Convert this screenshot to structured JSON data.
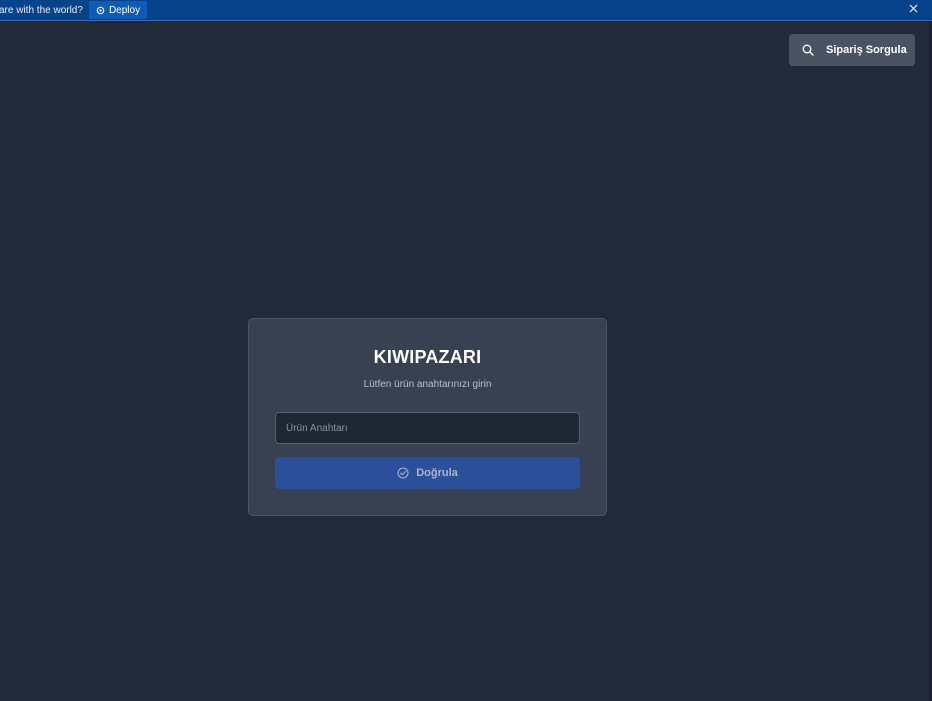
{
  "topbar": {
    "prompt_text": "are with the world?",
    "deploy_label": "Deploy",
    "icons": {
      "deploy": "rocket-icon",
      "close": "close-icon"
    }
  },
  "header": {
    "order_query_label": "Sipariş Sorgula",
    "icon": "search-icon"
  },
  "login_card": {
    "title": "KIWIPAZARI",
    "subtitle": "Lütfen ürün anahtarınızı girin",
    "key_input": {
      "value": "",
      "placeholder": "Ürün Anahtarı"
    },
    "verify_label": "Doğrula",
    "verify_icon": "check-circle-icon"
  },
  "colors": {
    "background": "#222938",
    "topbar": "#07438a",
    "card": "#374151",
    "button_primary": "#2c4f9a",
    "button_secondary": "#4a5363"
  }
}
